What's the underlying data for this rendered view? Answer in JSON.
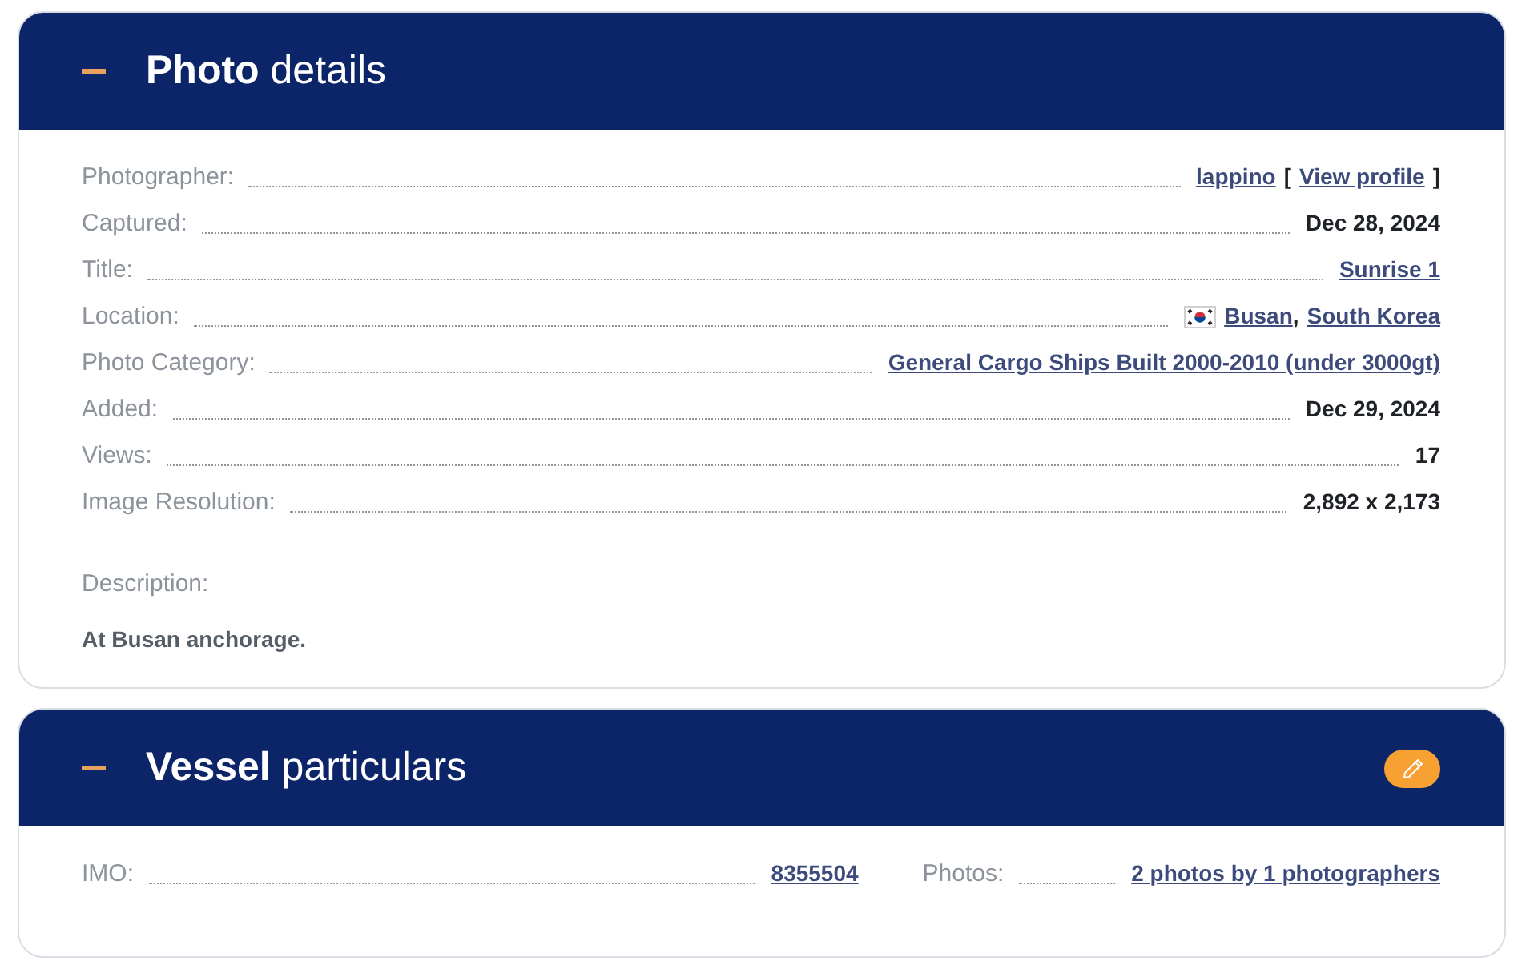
{
  "sections": [
    {
      "kind": "list",
      "title": "**Photo** details",
      "expanded": true,
      "editable": false,
      "fields": [
        {
          "label": "Photographer:",
          "value": [
            {
              "kind": "link",
              "text": "lappino"
            },
            {
              "kind": "bracket",
              "text": "["
            },
            {
              "kind": "link",
              "text": "View profile"
            },
            {
              "kind": "bracket",
              "text": "]"
            }
          ]
        },
        {
          "label": "Captured:",
          "value": [
            {
              "kind": "plain",
              "text": "Dec 28, 2024"
            }
          ]
        },
        {
          "label": "Title:",
          "value": [
            {
              "kind": "link",
              "text": "Sunrise 1"
            }
          ]
        },
        {
          "label": "Location:",
          "value": [
            {
              "kind": "flag"
            },
            {
              "kind": "link",
              "text": "Busan"
            },
            {
              "kind": "comma",
              "text": ","
            },
            {
              "kind": "link",
              "text": "South Korea"
            }
          ]
        },
        {
          "label": "Photo Category:",
          "value": [
            {
              "kind": "link",
              "text": "General Cargo Ships Built 2000-2010 (under 3000gt)"
            }
          ]
        },
        {
          "label": "Added:",
          "value": [
            {
              "kind": "plain",
              "text": "Dec 29, 2024"
            }
          ]
        },
        {
          "label": "Views:",
          "value": [
            {
              "kind": "plain",
              "text": "17"
            }
          ]
        },
        {
          "label": "Image Resolution:",
          "value": [
            {
              "kind": "plain",
              "text": "2,892 x 2,173"
            }
          ]
        }
      ],
      "description": {
        "label": "Description:",
        "text": "At Busan anchorage."
      }
    },
    {
      "kind": "grid",
      "title": "**Vessel** particulars",
      "expanded": true,
      "editable": true,
      "fields": [
        {
          "label": "IMO:",
          "value": [
            {
              "kind": "link",
              "text": "8355504"
            }
          ]
        },
        {
          "label": "Photos:",
          "value": [
            {
              "kind": "link",
              "text": "2 photos by 1 photographers"
            }
          ]
        }
      ]
    }
  ]
}
